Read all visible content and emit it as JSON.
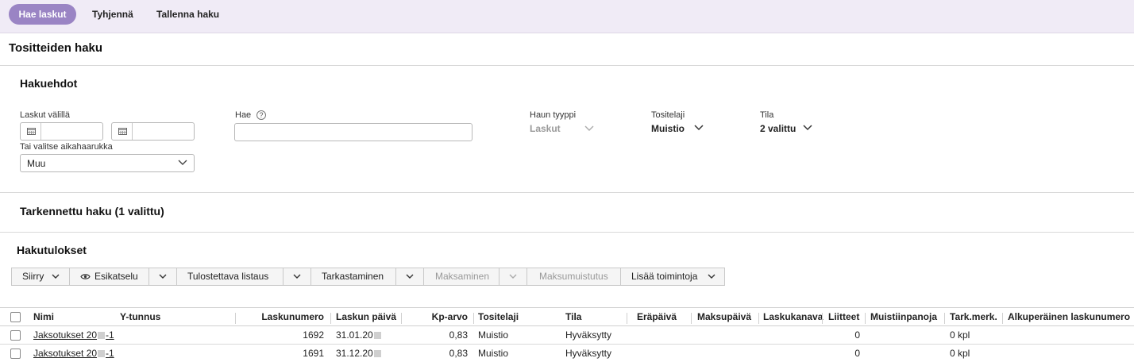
{
  "topbar": {
    "search_button": "Hae laskut",
    "clear_button": "Tyhjennä",
    "save_search_button": "Tallenna haku"
  },
  "page": {
    "title": "Tositteiden haku"
  },
  "criteria": {
    "title": "Hakuehdot",
    "date_range_label": "Laskut välillä",
    "date_start_value": "",
    "date_end_value": "",
    "period_label": "Tai valitse aikahaarukka",
    "period_value": "Muu",
    "search_label": "Hae",
    "search_value": "",
    "help_glyph": "?",
    "search_type_label": "Haun tyyppi",
    "search_type_value": "Laskut",
    "doc_type_label": "Tositelaji",
    "doc_type_value": "Muistio",
    "status_label": "Tila",
    "status_value": "2 valittu"
  },
  "advanced": {
    "title": "Tarkennettu haku (1 valittu)"
  },
  "results": {
    "title": "Hakutulokset",
    "toolbar": {
      "move": "Siirry",
      "preview": "Esikatselu",
      "print_list": "Tulostettava listaus",
      "review": "Tarkastaminen",
      "payment": "Maksaminen",
      "reminder": "Maksumuistutus",
      "more_actions": "Lisää toimintoja"
    },
    "columns": [
      "Nimi",
      "Y-tunnus",
      "Laskunumero",
      "Laskun päivä",
      "Kp-arvo",
      "Tositelaji",
      "Tila",
      "Eräpäivä",
      "Maksupäivä",
      "Laskukanava",
      "Liitteet",
      "Muistiinpanoja",
      "Tark.merk.",
      "Alkuperäinen laskunumero"
    ],
    "rows": [
      {
        "name_start": "Jaksotukset 20",
        "name_end": "-1",
        "ytunnus": "",
        "invoice_no": "1692",
        "date_start": "31.01.20",
        "kp_value": "0,83",
        "doc_type": "Muistio",
        "status": "Hyväksytty",
        "attachments": "0",
        "check": "0 kpl"
      },
      {
        "name_start": "Jaksotukset 20",
        "name_end": "-1",
        "ytunnus": "",
        "invoice_no": "1691",
        "date_start": "31.12.20",
        "kp_value": "0,83",
        "doc_type": "Muistio",
        "status": "Hyväksytty",
        "attachments": "0",
        "check": "0 kpl"
      }
    ]
  },
  "colors": {
    "accent": "#9a84c4",
    "topbar_bg": "#f0ebf6"
  },
  "icons": [
    "calendar-icon",
    "chevron-down-icon",
    "eye-icon",
    "help-icon"
  ]
}
